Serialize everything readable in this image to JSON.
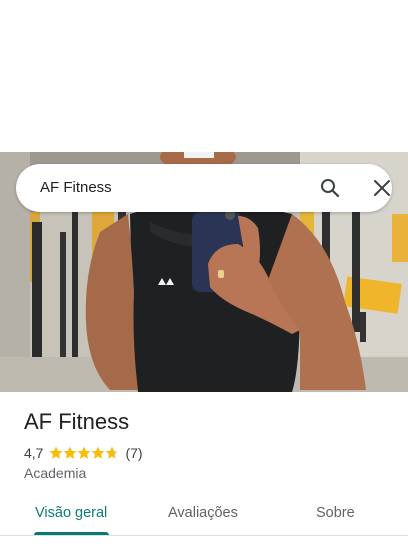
{
  "search": {
    "query": "AF Fitness",
    "icon": "search-icon",
    "close_icon": "close-icon"
  },
  "place": {
    "name": "AF Fitness",
    "rating": "4,7",
    "rating_value": 4.7,
    "max_rating": 5,
    "review_count": "(7)",
    "category": "Academia",
    "star_color": "#fbbc04"
  },
  "tabs": [
    {
      "label": "Visão geral",
      "active": true
    },
    {
      "label": "Avaliações",
      "active": false
    },
    {
      "label": "Sobre",
      "active": false
    }
  ],
  "colors": {
    "accent": "#0b7a76",
    "text": "#202124",
    "secondary_text": "#5f6368"
  }
}
